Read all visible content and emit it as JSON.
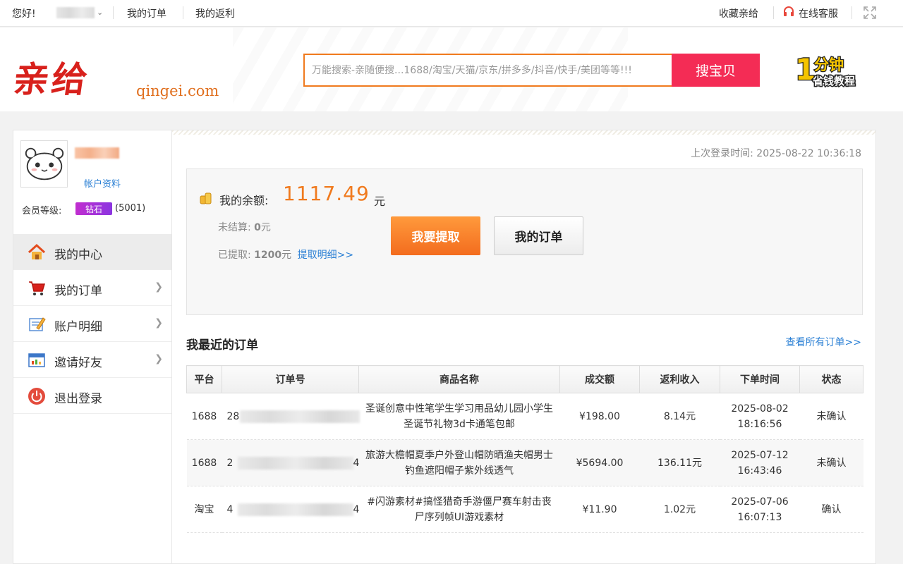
{
  "topbar": {
    "greeting": "您好!",
    "my_orders": "我的订单",
    "my_rebate": "我的返利",
    "favorite": "收藏亲给",
    "service": "在线客服"
  },
  "header": {
    "logo_cn": "亲给",
    "logo_en": "qingei.com",
    "search_placeholder": "万能搜索-亲随便搜...1688/淘宝/天猫/京东/拼多多/抖音/快手/美团等等!!!",
    "search_button": "搜宝贝",
    "badge_main": "1分钟",
    "badge_sub": "省钱教程"
  },
  "sidebar": {
    "account_link": "帐户资料",
    "member_label": "会员等级:",
    "member_badge": "钻石",
    "member_points": "(5001)",
    "items": [
      {
        "label": "我的中心",
        "icon": "home-icon"
      },
      {
        "label": "我的订单",
        "icon": "cart-icon"
      },
      {
        "label": "账户明细",
        "icon": "edit-icon"
      },
      {
        "label": "邀请好友",
        "icon": "chart-icon"
      },
      {
        "label": "退出登录",
        "icon": "power-icon"
      }
    ]
  },
  "main": {
    "last_login": "上次登录时间: 2025-08-22 10:36:18",
    "balance_label": "我的余额:",
    "balance_value": "1117.49",
    "balance_unit": "元",
    "unsettled_label": "未结算:",
    "unsettled_value": "0",
    "unsettled_unit": "元",
    "withdrawn_label": "已提取:",
    "withdrawn_value": "1200",
    "withdrawn_unit": "元",
    "withdraw_detail": "提取明细>>",
    "btn_withdraw": "我要提取",
    "btn_orders": "我的订单",
    "recent_title": "我最近的订单",
    "all_orders": "查看所有订单>>",
    "table": {
      "headers": [
        "平台",
        "订单号",
        "商品名称",
        "成交额",
        "返利收入",
        "下单时间",
        "状态"
      ],
      "rows": [
        {
          "platform": "1688",
          "order_first": "28",
          "order_last": "",
          "goods": "圣诞创意中性笔学生学习用品幼儿园小学生圣诞节礼物3d卡通笔包邮",
          "amount": "¥198.00",
          "rebate": "8.14元",
          "date": "2025-08-02",
          "time": "18:16:56",
          "status": "未确认"
        },
        {
          "platform": "1688",
          "order_first": "2",
          "order_last": "4",
          "goods": "旅游大檐帽夏季户外登山帽防晒渔夫帽男士钓鱼遮阳帽子紫外线透气",
          "amount": "¥5694.00",
          "rebate": "136.11元",
          "date": "2025-07-12",
          "time": "16:43:46",
          "status": "未确认"
        },
        {
          "platform": "淘宝",
          "order_first": "4",
          "order_last": "4",
          "goods": "#闪游素材#搞怪猎奇手游僵尸赛车射击丧尸序列帧UI游戏素材",
          "amount": "¥11.90",
          "rebate": "1.02元",
          "date": "2025-07-06",
          "time": "16:07:13",
          "status": "确认"
        }
      ]
    }
  },
  "colors": {
    "accent_orange": "#f07a1e",
    "search_button": "#f42c55",
    "link_blue": "#2a7fd4",
    "logo_red": "#d8211c"
  }
}
